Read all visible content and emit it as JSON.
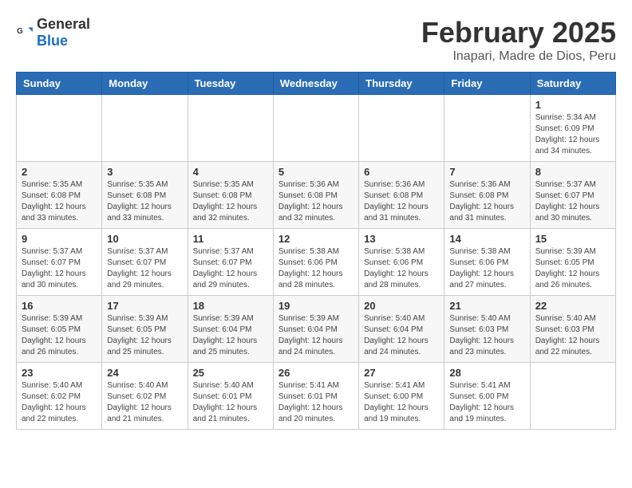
{
  "logo": {
    "general": "General",
    "blue": "Blue"
  },
  "title": "February 2025",
  "subtitle": "Inapari, Madre de Dios, Peru",
  "days_of_week": [
    "Sunday",
    "Monday",
    "Tuesday",
    "Wednesday",
    "Thursday",
    "Friday",
    "Saturday"
  ],
  "weeks": [
    [
      {
        "day": "",
        "info": ""
      },
      {
        "day": "",
        "info": ""
      },
      {
        "day": "",
        "info": ""
      },
      {
        "day": "",
        "info": ""
      },
      {
        "day": "",
        "info": ""
      },
      {
        "day": "",
        "info": ""
      },
      {
        "day": "1",
        "info": "Sunrise: 5:34 AM\nSunset: 6:09 PM\nDaylight: 12 hours and 34 minutes."
      }
    ],
    [
      {
        "day": "2",
        "info": "Sunrise: 5:35 AM\nSunset: 6:08 PM\nDaylight: 12 hours and 33 minutes."
      },
      {
        "day": "3",
        "info": "Sunrise: 5:35 AM\nSunset: 6:08 PM\nDaylight: 12 hours and 33 minutes."
      },
      {
        "day": "4",
        "info": "Sunrise: 5:35 AM\nSunset: 6:08 PM\nDaylight: 12 hours and 32 minutes."
      },
      {
        "day": "5",
        "info": "Sunrise: 5:36 AM\nSunset: 6:08 PM\nDaylight: 12 hours and 32 minutes."
      },
      {
        "day": "6",
        "info": "Sunrise: 5:36 AM\nSunset: 6:08 PM\nDaylight: 12 hours and 31 minutes."
      },
      {
        "day": "7",
        "info": "Sunrise: 5:36 AM\nSunset: 6:08 PM\nDaylight: 12 hours and 31 minutes."
      },
      {
        "day": "8",
        "info": "Sunrise: 5:37 AM\nSunset: 6:07 PM\nDaylight: 12 hours and 30 minutes."
      }
    ],
    [
      {
        "day": "9",
        "info": "Sunrise: 5:37 AM\nSunset: 6:07 PM\nDaylight: 12 hours and 30 minutes."
      },
      {
        "day": "10",
        "info": "Sunrise: 5:37 AM\nSunset: 6:07 PM\nDaylight: 12 hours and 29 minutes."
      },
      {
        "day": "11",
        "info": "Sunrise: 5:37 AM\nSunset: 6:07 PM\nDaylight: 12 hours and 29 minutes."
      },
      {
        "day": "12",
        "info": "Sunrise: 5:38 AM\nSunset: 6:06 PM\nDaylight: 12 hours and 28 minutes."
      },
      {
        "day": "13",
        "info": "Sunrise: 5:38 AM\nSunset: 6:06 PM\nDaylight: 12 hours and 28 minutes."
      },
      {
        "day": "14",
        "info": "Sunrise: 5:38 AM\nSunset: 6:06 PM\nDaylight: 12 hours and 27 minutes."
      },
      {
        "day": "15",
        "info": "Sunrise: 5:39 AM\nSunset: 6:05 PM\nDaylight: 12 hours and 26 minutes."
      }
    ],
    [
      {
        "day": "16",
        "info": "Sunrise: 5:39 AM\nSunset: 6:05 PM\nDaylight: 12 hours and 26 minutes."
      },
      {
        "day": "17",
        "info": "Sunrise: 5:39 AM\nSunset: 6:05 PM\nDaylight: 12 hours and 25 minutes."
      },
      {
        "day": "18",
        "info": "Sunrise: 5:39 AM\nSunset: 6:04 PM\nDaylight: 12 hours and 25 minutes."
      },
      {
        "day": "19",
        "info": "Sunrise: 5:39 AM\nSunset: 6:04 PM\nDaylight: 12 hours and 24 minutes."
      },
      {
        "day": "20",
        "info": "Sunrise: 5:40 AM\nSunset: 6:04 PM\nDaylight: 12 hours and 24 minutes."
      },
      {
        "day": "21",
        "info": "Sunrise: 5:40 AM\nSunset: 6:03 PM\nDaylight: 12 hours and 23 minutes."
      },
      {
        "day": "22",
        "info": "Sunrise: 5:40 AM\nSunset: 6:03 PM\nDaylight: 12 hours and 22 minutes."
      }
    ],
    [
      {
        "day": "23",
        "info": "Sunrise: 5:40 AM\nSunset: 6:02 PM\nDaylight: 12 hours and 22 minutes."
      },
      {
        "day": "24",
        "info": "Sunrise: 5:40 AM\nSunset: 6:02 PM\nDaylight: 12 hours and 21 minutes."
      },
      {
        "day": "25",
        "info": "Sunrise: 5:40 AM\nSunset: 6:01 PM\nDaylight: 12 hours and 21 minutes."
      },
      {
        "day": "26",
        "info": "Sunrise: 5:41 AM\nSunset: 6:01 PM\nDaylight: 12 hours and 20 minutes."
      },
      {
        "day": "27",
        "info": "Sunrise: 5:41 AM\nSunset: 6:00 PM\nDaylight: 12 hours and 19 minutes."
      },
      {
        "day": "28",
        "info": "Sunrise: 5:41 AM\nSunset: 6:00 PM\nDaylight: 12 hours and 19 minutes."
      },
      {
        "day": "",
        "info": ""
      }
    ]
  ]
}
